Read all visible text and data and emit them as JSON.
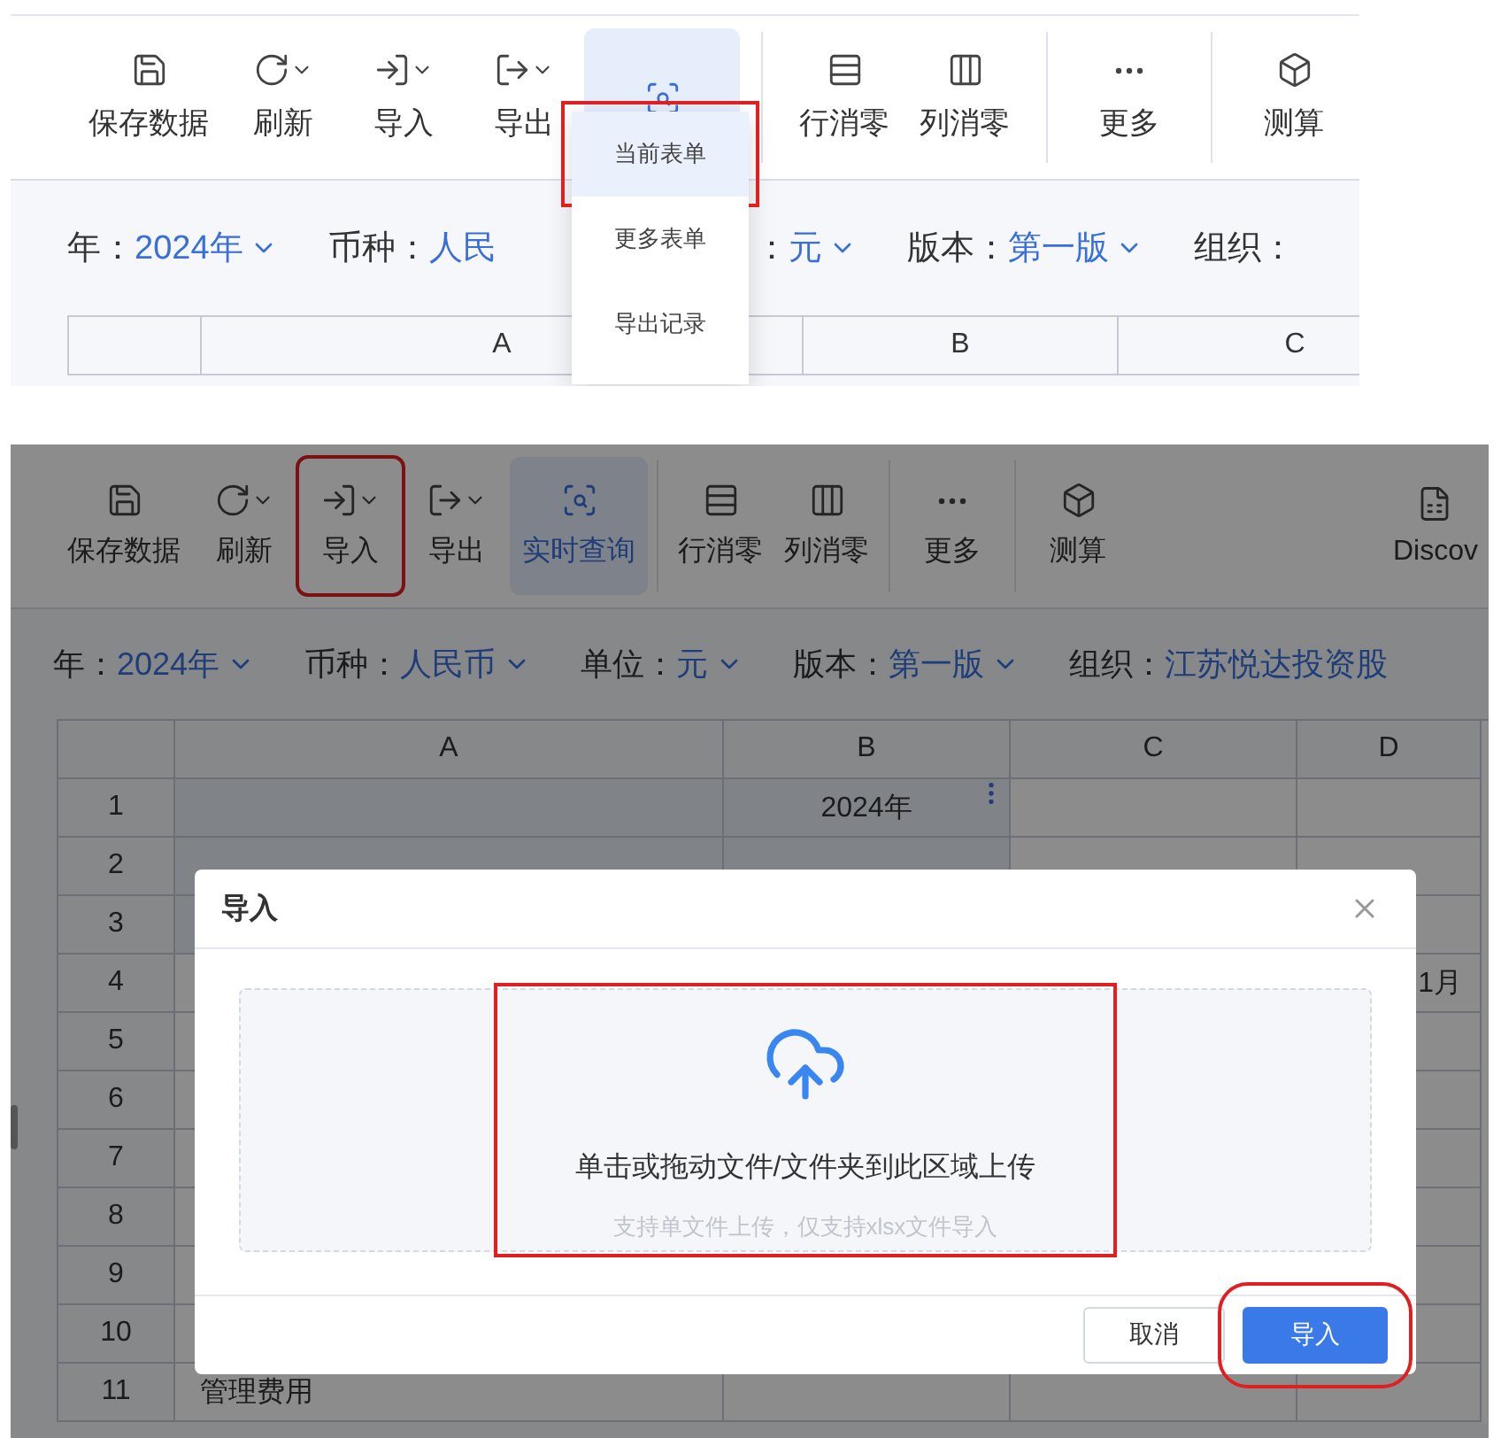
{
  "panels": [
    {
      "toolbar": {
        "groups": [
          [
            {
              "label": "保存数据",
              "caret": false,
              "selected": false,
              "highlighted": false
            },
            {
              "label": "刷新",
              "caret": true,
              "selected": false,
              "highlighted": false
            },
            {
              "label": "导入",
              "caret": true,
              "selected": false,
              "highlighted": false
            },
            {
              "label": "导出",
              "caret": true,
              "selected": false,
              "highlighted": false
            },
            {
              "caret": false,
              "selected": true,
              "highlighted": false
            }
          ],
          [
            {
              "label": "行消零",
              "caret": false,
              "selected": false,
              "highlighted": false
            },
            {
              "label": "列消零",
              "caret": false,
              "selected": false,
              "highlighted": false
            }
          ],
          [
            {
              "label": "更多",
              "caret": false,
              "selected": false,
              "highlighted": false
            }
          ],
          [
            {
              "label": "测算",
              "caret": false,
              "selected": false,
              "highlighted": false
            }
          ]
        ]
      },
      "menu": {
        "items": [
          {
            "label": "当前表单",
            "selected": true,
            "highlighted": true
          },
          {
            "label": "更多表单",
            "selected": false,
            "highlighted": false
          },
          {
            "label": "导出记录",
            "selected": false,
            "highlighted": false
          }
        ]
      },
      "filters": [
        {
          "label": "年：",
          "value": "2024年",
          "caret": true
        },
        {
          "label": "币种：",
          "value": "人民",
          "caret": false
        },
        {
          "label": "：",
          "value": "元",
          "caret": true
        },
        {
          "label": "版本：",
          "value": "第一版",
          "caret": true
        },
        {
          "label": "组织："
        }
      ],
      "table": {
        "columns": [
          "A",
          "B",
          "C"
        ]
      }
    },
    {
      "toolbar": {
        "groups": [
          [
            {
              "label": "保存数据",
              "caret": false,
              "selected": false,
              "highlighted": false
            },
            {
              "label": "刷新",
              "caret": true,
              "selected": false,
              "highlighted": false
            },
            {
              "label": "导入",
              "caret": true,
              "selected": false,
              "highlighted": true
            },
            {
              "label": "导出",
              "caret": true,
              "selected": false,
              "highlighted": false
            },
            {
              "label": "实时查询",
              "caret": false,
              "selected": true,
              "highlighted": false
            }
          ],
          [
            {
              "label": "行消零",
              "caret": false,
              "selected": false,
              "highlighted": false
            },
            {
              "label": "列消零",
              "caret": false,
              "selected": false,
              "highlighted": false
            }
          ],
          [
            {
              "label": "更多",
              "caret": false,
              "selected": false,
              "highlighted": false
            }
          ],
          [
            {
              "label": "测算",
              "caret": false,
              "selected": false,
              "highlighted": false
            },
            {
              "label": "Discov",
              "caret": false,
              "selected": false,
              "highlighted": false
            }
          ]
        ]
      },
      "filters": [
        {
          "label": "年：",
          "value": "2024年",
          "caret": true
        },
        {
          "label": "币种：",
          "value": "人民币",
          "caret": true
        },
        {
          "label": "单位：",
          "value": "元",
          "caret": true
        },
        {
          "label": "版本：",
          "value": "第一版",
          "caret": true
        },
        {
          "label": "组织：",
          "value": "江苏悦达投资股",
          "caret": false
        }
      ],
      "table": {
        "columns": [
          "A",
          "B",
          "C",
          "D"
        ],
        "rows": [
          {
            "num": "1",
            "b": "2024年"
          },
          {
            "num": "2"
          },
          {
            "num": "3"
          },
          {
            "num": "4",
            "d": "1月"
          },
          {
            "num": "5"
          },
          {
            "num": "6"
          },
          {
            "num": "7"
          },
          {
            "num": "8"
          },
          {
            "num": "9"
          },
          {
            "num": "10"
          },
          {
            "num": "11",
            "a": "管理费用"
          }
        ]
      },
      "dialog": {
        "title": "导入",
        "upload": {
          "text": "单击或拖动文件/文件夹到此区域上传",
          "hint": "支持单文件上传，仅支持xlsx文件导入",
          "highlighted": true
        },
        "buttons": [
          {
            "label": "取消",
            "kind": "default",
            "highlighted": false
          },
          {
            "label": "导入",
            "kind": "primary",
            "highlighted": true
          }
        ]
      }
    }
  ]
}
